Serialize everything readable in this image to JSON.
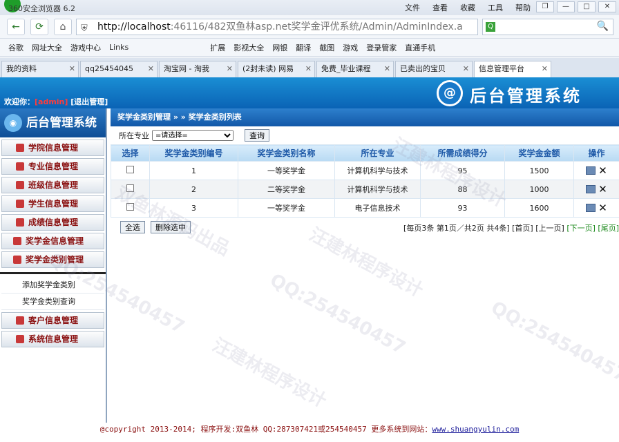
{
  "browser": {
    "app_name": "360安全浏览器 6.2",
    "menus": [
      "文件",
      "查看",
      "收藏",
      "工具",
      "帮助"
    ],
    "window_buttons": [
      "❐",
      "—",
      "□",
      "✕"
    ],
    "url_host": "http://localhost",
    "url_path": ":46116/482双鱼林asp.net奖学金评优系统/Admin/AdminIndex.a",
    "favorites": [
      "谷歌",
      "网址大全",
      "游戏中心",
      "Links",
      "扩展",
      "影视大全",
      "网银",
      "翻译",
      "截图",
      "游戏",
      "登录管家",
      "直通手机"
    ],
    "tabs": [
      {
        "label": "我的资料",
        "active": false
      },
      {
        "label": "qq25454045",
        "active": false
      },
      {
        "label": "淘宝网 - 淘我",
        "active": false
      },
      {
        "label": "(2封未读) 网易",
        "active": false
      },
      {
        "label": "免费_毕业课程",
        "active": false
      },
      {
        "label": "已卖出的宝贝",
        "active": false
      },
      {
        "label": "信息管理平台",
        "active": true
      }
    ]
  },
  "header": {
    "welcome_label": "欢迎你：",
    "username": "[admin]",
    "logout": "[退出管理]",
    "title": "后台管理系统"
  },
  "sidebar": {
    "title": "后台管理系统",
    "items_top": [
      "学院信息管理",
      "专业信息管理",
      "班级信息管理",
      "学生信息管理",
      "成绩信息管理",
      "奖学金信息管理",
      "奖学金类别管理"
    ],
    "sub_items": [
      "添加奖学金类别",
      "奖学金类别查询"
    ],
    "items_bottom": [
      "客户信息管理",
      "系统信息管理"
    ]
  },
  "main": {
    "breadcrumb": "奖学金类别管理 » » 奖学金类别列表",
    "filter_label": "所在专业",
    "filter_selected": "=请选择=",
    "query_button": "查询",
    "columns": [
      "选择",
      "奖学金类别编号",
      "奖学金类别名称",
      "所在专业",
      "所需成绩得分",
      "奖学金金额",
      "操作"
    ],
    "rows": [
      {
        "id": "1",
        "name": "一等奖学金",
        "major": "计算机科学与技术",
        "score": "95",
        "amount": "1500"
      },
      {
        "id": "2",
        "name": "二等奖学金",
        "major": "计算机科学与技术",
        "score": "88",
        "amount": "1000"
      },
      {
        "id": "3",
        "name": "一等奖学金",
        "major": "电子信息技术",
        "score": "93",
        "amount": "1600"
      }
    ],
    "select_all": "全选",
    "delete_selected": "删除选中",
    "pager_info": "[每页3条 第1页／共2页 共4条]",
    "pager_first": "[首页]",
    "pager_prev": "[上一页]",
    "pager_next": "[下一页]",
    "pager_last": "[尾页]"
  },
  "footer": {
    "text": "@copyright 2013-2014; 程序开发:双鱼林  QQ:287307421或254540457  更多系统到网站：",
    "link": "www.shuangyulin.com"
  },
  "watermarks": [
    "QQ:254540457",
    "汪建林程序设计",
    "双鱼林源码出品"
  ]
}
